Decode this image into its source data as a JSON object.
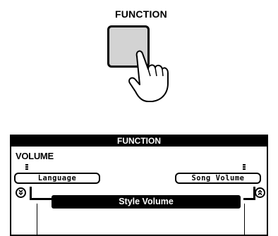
{
  "function_button": {
    "label": "FUNCTION",
    "icon": "pressing-hand-icon",
    "button_color": "#d3d3d3"
  },
  "lcd": {
    "header": "FUNCTION",
    "title": "VOLUME",
    "left_option": "Language",
    "right_option": "Song Volume",
    "selected_item": "Style Volume",
    "scroll_down_icon": "double-chevron-down-icon",
    "scroll_up_icon": "double-chevron-up-icon"
  }
}
